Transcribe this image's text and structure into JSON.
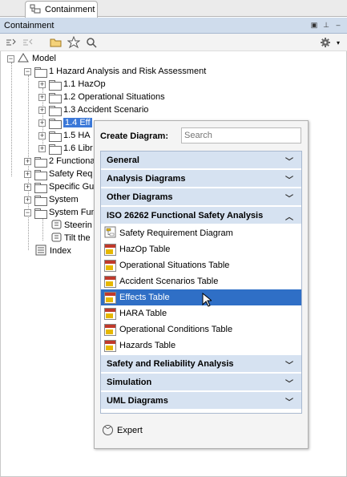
{
  "tab": {
    "label": "Containment"
  },
  "panel": {
    "title": "Containment"
  },
  "tree": {
    "model": "Model",
    "hazard": "1 Hazard Analysis and Risk Assessment",
    "hazop": "1.1 HazOp",
    "opsit": "1.2 Operational Situations",
    "accident": "1.3 Accident Scenario",
    "effects": "1.4 Eff",
    "hara": "1.5 HA",
    "lib": "1.6 Libr",
    "functional": "2 Functional",
    "safetyreq": "Safety Req",
    "specific": "Specific Gu",
    "system": "System",
    "systemfun": "System Fun",
    "steering": "Steerin",
    "tilt": "Tilt the",
    "index": "Index"
  },
  "popup": {
    "label": "Create Diagram:",
    "search_placeholder": "Search",
    "categories": {
      "general": "General",
      "analysis": "Analysis Diagrams",
      "other": "Other Diagrams",
      "iso": "ISO 26262 Functional Safety Analysis",
      "safety": "Safety and Reliability Analysis",
      "simulation": "Simulation",
      "uml": "UML Diagrams"
    },
    "items": [
      "Safety Requirement Diagram",
      "HazOp Table",
      "Operational Situations Table",
      "Accident Scenarios Table",
      "Effects Table",
      "HARA Table",
      "Operational Conditions Table",
      "Hazards Table"
    ],
    "expert": "Expert"
  }
}
